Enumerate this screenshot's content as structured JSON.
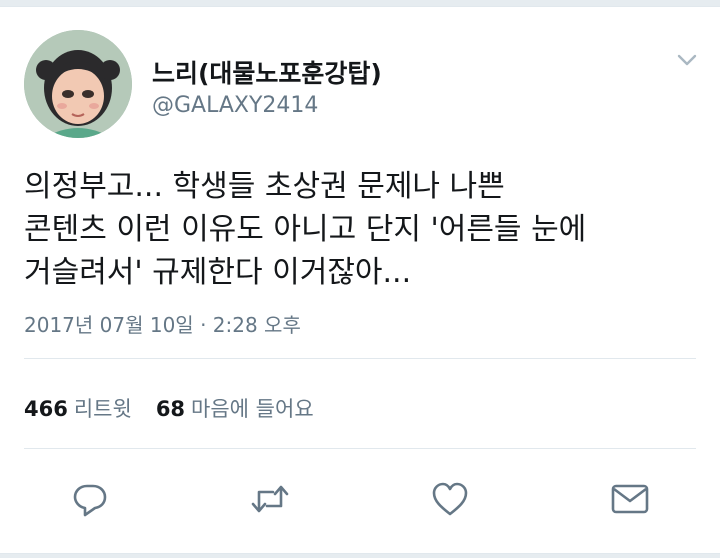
{
  "tweet": {
    "display_name": "느리(대물노포훈강탑)",
    "handle": "@GALAXY2414",
    "text_lines": [
      "의정부고... 학생들 초상권 문제나 나쁜",
      "콘텐츠 이런 이유도 아니고 단지 '어른들 눈에",
      "거슬려서' 규제한다 이거잖아..."
    ],
    "timestamp": "2017년 07월 10일 · 2:28 오후",
    "retweet_count": "466",
    "retweet_label": "리트윗",
    "like_count": "68",
    "like_label": "마음에 들어요"
  },
  "icons": {
    "menu": "chevron-down-icon",
    "reply": "reply-icon",
    "retweet": "retweet-icon",
    "like": "heart-icon",
    "message": "envelope-icon"
  },
  "colors": {
    "text": "#14171a",
    "secondary": "#657786",
    "divider": "#e1e8ed",
    "icon": "#657786",
    "page_background": "#e6ecf0"
  }
}
